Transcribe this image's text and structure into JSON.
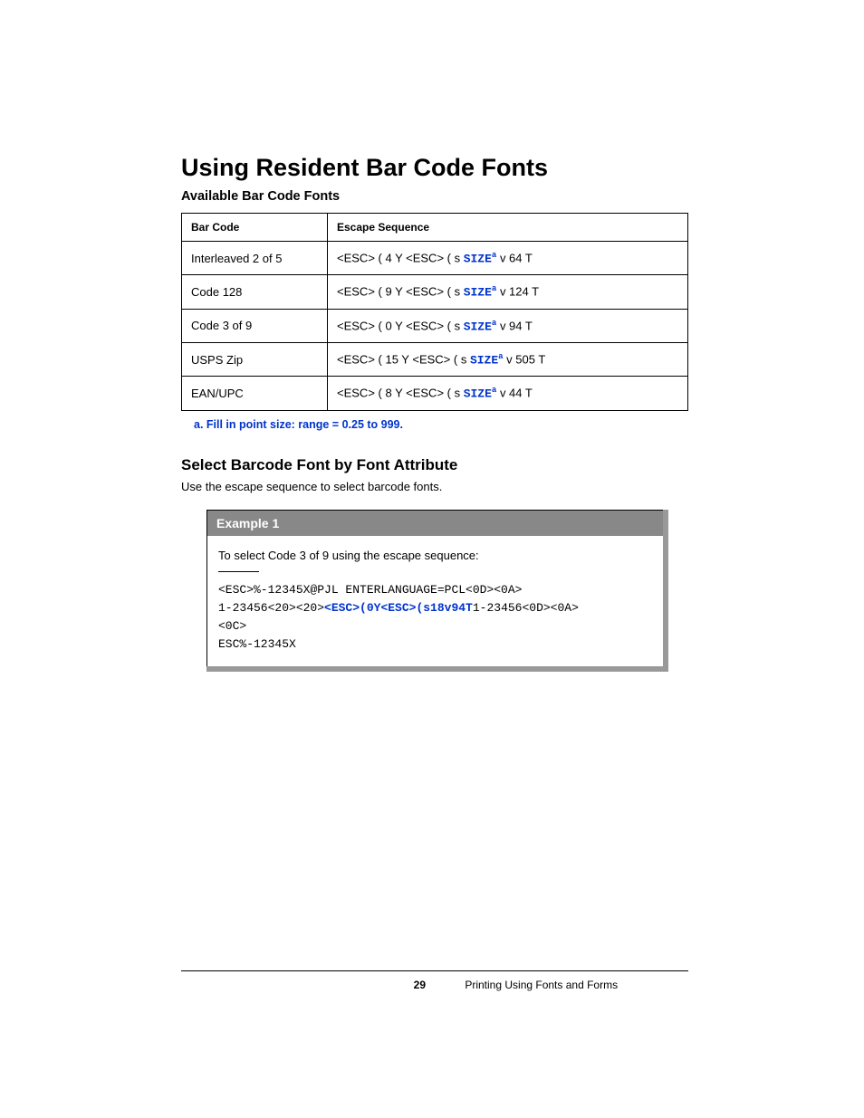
{
  "heading": "Using Resident Bar Code Fonts",
  "tableTitle": "Available Bar Code Fonts",
  "tableHeaders": {
    "col1": "Bar Code",
    "col2": "Escape Sequence"
  },
  "rows": [
    {
      "name": "Interleaved 2 of 5",
      "pre": "<ESC> ( 4 Y <ESC> ( s ",
      "post": " v 64 T"
    },
    {
      "name": "Code 128",
      "pre": "<ESC> ( 9 Y <ESC> ( s ",
      "post": " v 124 T"
    },
    {
      "name": "Code 3 of 9",
      "pre": "<ESC> ( 0 Y <ESC> ( s ",
      "post": " v 94 T"
    },
    {
      "name": "USPS Zip",
      "pre": "<ESC> ( 15 Y <ESC> ( s ",
      "post": " v 505 T"
    },
    {
      "name": "EAN/UPC",
      "pre": "<ESC> ( 8 Y <ESC> ( s ",
      "post": " v 44 T"
    }
  ],
  "sizeKeyword": "SIZE",
  "sizeSup": "a",
  "footnote": "a. Fill in point size: range = 0.25 to 999.",
  "section2": {
    "title": "Select Barcode Font by Font Attribute",
    "body": "Use the escape sequence to select barcode fonts."
  },
  "example": {
    "header": "Example 1",
    "intro": "To select Code 3 of 9 using the escape sequence:",
    "line1": "<ESC>%-12345X@PJL ENTERLANGUAGE=PCL<0D><0A>",
    "line2a": "1-23456<20><20>",
    "line2blue": "<ESC>(0Y<ESC>(s18v94T",
    "line2b": "1-23456<0D><0A>",
    "line3": "<0C>",
    "line4": "ESC%-12345X"
  },
  "footer": {
    "pageNumber": "29",
    "chapter": "Printing Using Fonts and Forms"
  }
}
